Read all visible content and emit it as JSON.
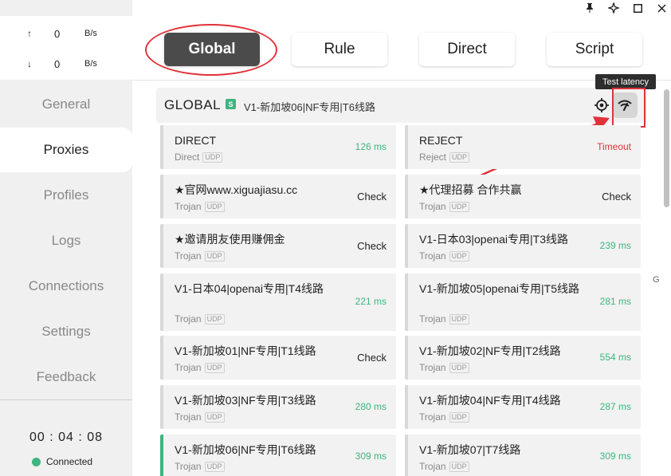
{
  "window": {
    "controls": [
      "pin-icon",
      "restore-icon",
      "maximize-icon",
      "close-icon"
    ]
  },
  "traffic": {
    "up": {
      "arrow": "↑",
      "value": "0",
      "unit": "B/s"
    },
    "down": {
      "arrow": "↓",
      "value": "0",
      "unit": "B/s"
    }
  },
  "nav": [
    "General",
    "Proxies",
    "Profiles",
    "Logs",
    "Connections",
    "Settings",
    "Feedback"
  ],
  "status": {
    "time": "00 : 04 : 08",
    "connection": "Connected"
  },
  "modes": [
    "Global",
    "Rule",
    "Direct",
    "Script"
  ],
  "group": {
    "name": "GLOBAL",
    "badge": "S",
    "now": "V1-新加坡06|NF专用|T6线路",
    "tooltip": "Test latency"
  },
  "proxies": [
    {
      "name": "DIRECT",
      "type": "Direct",
      "udp": "UDP",
      "delay": "126 ms",
      "state": "ok"
    },
    {
      "name": "REJECT",
      "type": "Reject",
      "udp": "UDP",
      "delay": "Timeout",
      "state": "timeout"
    },
    {
      "name": "★官网www.xiguajiasu.cc",
      "type": "Trojan",
      "udp": "UDP",
      "delay": "Check",
      "state": "check"
    },
    {
      "name": "★代理招募 合作共赢",
      "type": "Trojan",
      "udp": "UDP",
      "delay": "Check",
      "state": "check"
    },
    {
      "name": "★邀请朋友使用赚佣金",
      "type": "Trojan",
      "udp": "UDP",
      "delay": "Check",
      "state": "check"
    },
    {
      "name": "V1-日本03|openai专用|T3线路",
      "type": "Trojan",
      "udp": "UDP",
      "delay": "239 ms",
      "state": "ok"
    },
    {
      "name": "V1-日本04|openai专用|T4线路",
      "type": "Trojan",
      "udp": "UDP",
      "delay": "221 ms",
      "state": "ok"
    },
    {
      "name": "V1-新加坡05|openai专用|T5线路",
      "type": "Trojan",
      "udp": "UDP",
      "delay": "281 ms",
      "state": "ok"
    },
    {
      "name": "V1-新加坡01|NF专用|T1线路",
      "type": "Trojan",
      "udp": "UDP",
      "delay": "Check",
      "state": "check"
    },
    {
      "name": "V1-新加坡02|NF专用|T2线路",
      "type": "Trojan",
      "udp": "UDP",
      "delay": "554 ms",
      "state": "ok"
    },
    {
      "name": "V1-新加坡03|NF专用|T3线路",
      "type": "Trojan",
      "udp": "UDP",
      "delay": "280 ms",
      "state": "ok"
    },
    {
      "name": "V1-新加坡04|NF专用|T4线路",
      "type": "Trojan",
      "udp": "UDP",
      "delay": "287 ms",
      "state": "ok"
    },
    {
      "name": "V1-新加坡06|NF专用|T6线路",
      "type": "Trojan",
      "udp": "UDP",
      "delay": "309 ms",
      "state": "ok",
      "selected": true
    },
    {
      "name": "V1-新加坡07|T7线路",
      "type": "Trojan",
      "udp": "UDP",
      "delay": "309 ms",
      "state": "ok"
    }
  ],
  "side_glyph": "G",
  "colors": {
    "accent": "#3db57f",
    "annotation": "#e0323a",
    "timeout": "#e0323a"
  }
}
